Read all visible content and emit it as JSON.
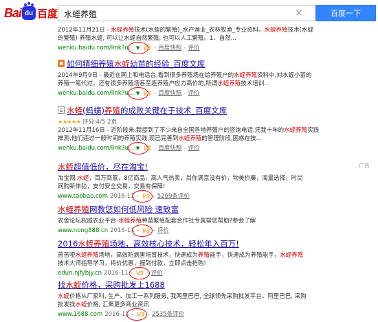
{
  "header": {
    "logo_bai": "Bai",
    "logo_du": "du",
    "logo_cn": "百度",
    "query": "水蛭养殖",
    "clear": "×",
    "search_button": "百度一下"
  },
  "results": [
    {
      "date_line": "2012年11月21日 - 水蛭养殖技术(水蛭的繁殖)_水产渔业_农林牧渔_专业资料。水蛭养殖技术(水蛭",
      "snip2": "的繁殖) 养殖水蛭, 可以让水蛭自然繁殖, 也可以人工繁殖。1、自然...",
      "url": "wenku.baidu.com/link?u...",
      "snapshot": "百度快照",
      "eval": "评价"
    },
    {
      "title": "如何精细养殖水蛭幼苗的经验_百度文库",
      "snip1": "2014年9月9日 - 最近在网上和电话台,看到很多养殖场在给养殖户的水蛭养殖资料中,对水蛭小苗的",
      "snip2": "养殖一笔代过。还有很多养殖场甚至连养殖户应力高价的,所谓水蛭养殖技术培训...",
      "url": "wenku.baidu.com/link?u...",
      "snapshot": "百度快照",
      "eval": "评价"
    },
    {
      "title": "水蛭(蚂蟥)养殖的成败关键在于技术_百度文库",
      "rating": "★★★★★",
      "rating_text": "评分:4/5 2页",
      "snip1": "2012年11月16日 - 近阶段来,我接到了不少来自全国各地养殖户的咨询电话,凭我十年的水蛭养殖实践",
      "snip2": "推测,他们违过一般时间的养殖实践,现已完善到水蛭养殖的管理阶段,困惑在技...",
      "url": "wenku.baidu.com/link?u...",
      "snapshot": "百度快照",
      "eval": "评价"
    }
  ],
  "ads": {
    "label": "广告",
    "items": [
      {
        "title": "水蛭超值低价，尽在淘宝!",
        "desc1": "淘宝网 水蛭，百万商家，8亿商品，高人气热卖，尚你满意没有价，物美价廉，海量选择，时尚",
        "desc2": "网购新体验，支付安全交易，交易有保障!",
        "url": "www.taobao.com",
        "date": "2016-11",
        "eval": "5269条评价"
      },
      {
        "title": "水蛭养殖网教您如何低风险 速致富",
        "desc1": "农舍论坛权威农业平台-水蛭养殖种苗繁殖配套合作社专属帮您帮助?参会了解",
        "url": "www.nong888.cn",
        "date": "2016-11",
        "eval": "评价"
      },
      {
        "title": "2016水蛭养殖场地，高效核心技术，轻松年入百万!",
        "desc1": "苦苦哑水蛭养殖场地，高效防病害培育技术，快速成为养殖能手，快速成为养殖能手，水蛭养殖",
        "desc2": "技术大师指导学习，将价优惠，报到付款，立即点击抢购!",
        "url": "edun.njfybjy.cn",
        "date": "2016-11",
        "eval": "评价"
      },
      {
        "title": "找水蛭价格，采购批发上1688",
        "desc1": "水蛭价格从厂家科, 生产、加工一系列服务, 我两里巴巴, 全球领先采购批发平台。阿里巴巴, 采购",
        "desc2": "批发找水蛭价格, 汇聚更多商业资讯",
        "url": "www.1688.com",
        "date": "2016-11",
        "eval": "2535条评价"
      }
    ]
  },
  "v3_badge": "V3"
}
